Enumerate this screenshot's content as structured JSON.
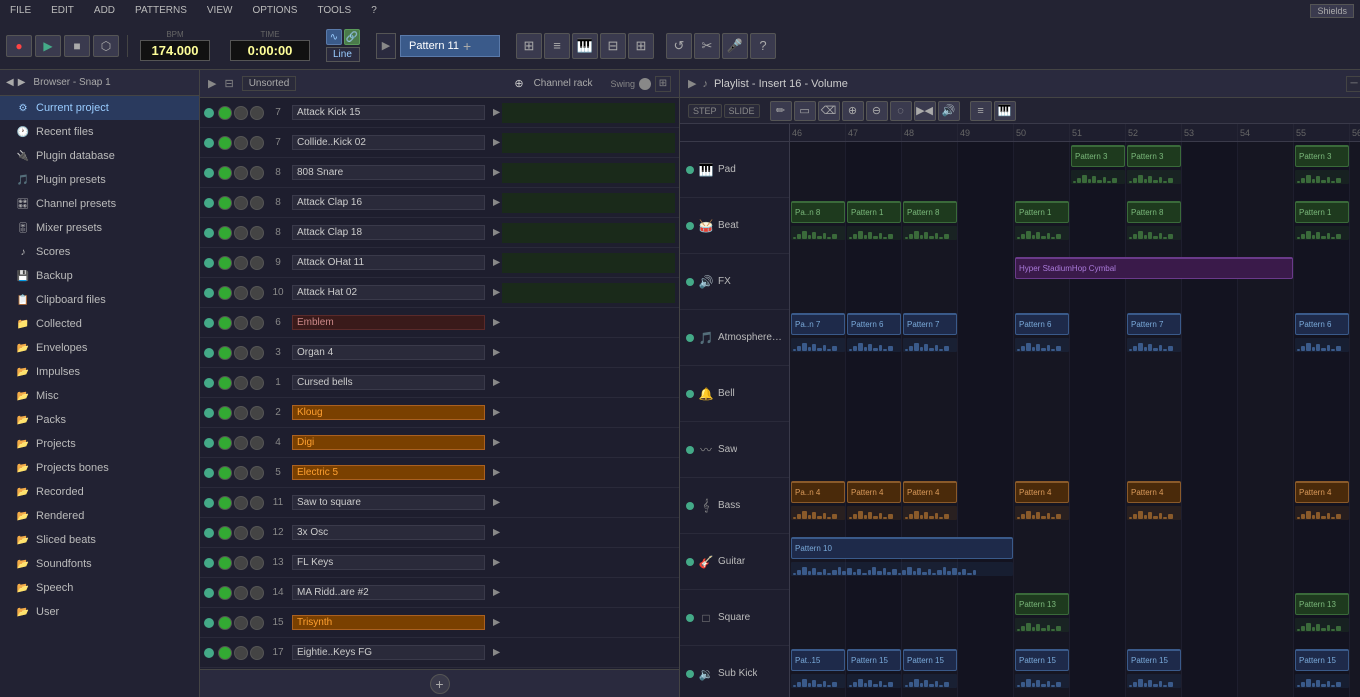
{
  "menu": {
    "items": [
      "FILE",
      "EDIT",
      "ADD",
      "PATTERNS",
      "VIEW",
      "OPTIONS",
      "TOOLS",
      "?"
    ]
  },
  "transport": {
    "bpm": "174.000",
    "time": "0:00:00",
    "pattern": "Pattern 11",
    "line_mode": "Line",
    "buttons": {
      "record": "●",
      "play": "▶",
      "stop": "■",
      "pattern": "⬡"
    }
  },
  "channel_rack": {
    "title": "Channel rack",
    "label_unsorted": "Unsorted",
    "swing_label": "Swing",
    "channels": [
      {
        "num": "7",
        "name": "Attack Kick 15",
        "color": "default",
        "led": true
      },
      {
        "num": "7",
        "name": "Collide..Kick 02",
        "color": "default",
        "led": true
      },
      {
        "num": "8",
        "name": "808 Snare",
        "color": "default",
        "led": true
      },
      {
        "num": "8",
        "name": "Attack Clap 16",
        "color": "default",
        "led": true
      },
      {
        "num": "8",
        "name": "Attack Clap 18",
        "color": "default",
        "led": true
      },
      {
        "num": "9",
        "name": "Attack OHat 11",
        "color": "default",
        "led": true
      },
      {
        "num": "10",
        "name": "Attack Hat 02",
        "color": "default",
        "led": true
      },
      {
        "num": "6",
        "name": "Emblem",
        "color": "dark",
        "led": true
      },
      {
        "num": "3",
        "name": "Organ 4",
        "color": "default",
        "led": true
      },
      {
        "num": "1",
        "name": "Cursed bells",
        "color": "default",
        "led": true
      },
      {
        "num": "2",
        "name": "Kloug",
        "color": "orange",
        "led": true
      },
      {
        "num": "4",
        "name": "Digi",
        "color": "orange",
        "led": true
      },
      {
        "num": "5",
        "name": "Electric 5",
        "color": "orange",
        "led": true
      },
      {
        "num": "11",
        "name": "Saw to square",
        "color": "default",
        "led": true
      },
      {
        "num": "12",
        "name": "3x Osc",
        "color": "default",
        "led": true
      },
      {
        "num": "13",
        "name": "FL Keys",
        "color": "default",
        "led": true
      },
      {
        "num": "14",
        "name": "MA Ridd..are #2",
        "color": "default",
        "led": true
      },
      {
        "num": "15",
        "name": "Trisynth",
        "color": "orange",
        "led": true
      },
      {
        "num": "17",
        "name": "Eightie..Keys FG",
        "color": "default",
        "led": true
      }
    ]
  },
  "sidebar": {
    "header": "Browser - Snap 1",
    "items": [
      {
        "label": "Current project",
        "icon": "🏠",
        "type": "active"
      },
      {
        "label": "Recent files",
        "icon": "🕐",
        "type": "folder"
      },
      {
        "label": "Plugin database",
        "icon": "🔌",
        "type": "folder"
      },
      {
        "label": "Plugin presets",
        "icon": "🎵",
        "type": "folder"
      },
      {
        "label": "Channel presets",
        "icon": "🎛",
        "type": "folder"
      },
      {
        "label": "Mixer presets",
        "icon": "🎚",
        "type": "folder"
      },
      {
        "label": "Scores",
        "icon": "♪",
        "type": "folder"
      },
      {
        "label": "Backup",
        "icon": "💾",
        "type": "folder"
      },
      {
        "label": "Clipboard files",
        "icon": "📋",
        "type": "folder"
      },
      {
        "label": "Collected",
        "icon": "📁",
        "type": "folder"
      },
      {
        "label": "Envelopes",
        "icon": "📁",
        "type": "folder"
      },
      {
        "label": "Impulses",
        "icon": "📁",
        "type": "folder"
      },
      {
        "label": "Misc",
        "icon": "📁",
        "type": "folder"
      },
      {
        "label": "Packs",
        "icon": "📁",
        "type": "folder"
      },
      {
        "label": "Projects",
        "icon": "📁",
        "type": "folder"
      },
      {
        "label": "Projects bones",
        "icon": "📁",
        "type": "folder"
      },
      {
        "label": "Recorded",
        "icon": "📁",
        "type": "folder"
      },
      {
        "label": "Rendered",
        "icon": "📁",
        "type": "folder"
      },
      {
        "label": "Sliced beats",
        "icon": "📁",
        "type": "folder"
      },
      {
        "label": "Soundfonts",
        "icon": "📁",
        "type": "folder"
      },
      {
        "label": "Speech",
        "icon": "📁",
        "type": "folder"
      },
      {
        "label": "User",
        "icon": "📁",
        "type": "folder"
      }
    ]
  },
  "playlist": {
    "title": "Playlist - Insert 16 - Volume",
    "timeline_marks": [
      "46",
      "47",
      "48",
      "49",
      "50",
      "51",
      "52",
      "53",
      "54",
      "55",
      "56"
    ],
    "tracks": [
      {
        "name": "Pad",
        "icon": "🎹",
        "patterns": [
          {
            "label": "Pattern 3",
            "start": 5,
            "width": 1,
            "color": "green"
          },
          {
            "label": "Pattern 3",
            "start": 6,
            "width": 1,
            "color": "green"
          },
          {
            "label": "Pattern 3",
            "start": 9,
            "width": 1,
            "color": "green"
          }
        ]
      },
      {
        "name": "Beat",
        "icon": "🥁",
        "patterns": [
          {
            "label": "Pa..n 8",
            "start": 0,
            "width": 1,
            "color": "green"
          },
          {
            "label": "Pattern 1",
            "start": 1,
            "width": 1,
            "color": "green"
          },
          {
            "label": "Pattern 8",
            "start": 2,
            "width": 1,
            "color": "green"
          },
          {
            "label": "Pattern 1",
            "start": 4,
            "width": 1,
            "color": "green"
          },
          {
            "label": "Pattern 8",
            "start": 6,
            "width": 1,
            "color": "green"
          },
          {
            "label": "Pattern 1",
            "start": 9,
            "width": 1,
            "color": "green"
          }
        ]
      },
      {
        "name": "FX",
        "icon": "🔊",
        "patterns": [
          {
            "label": "Hyper StadiumHop Cymbal",
            "start": 4,
            "width": 5,
            "color": "purple"
          }
        ]
      },
      {
        "name": "Atmosphere Arp",
        "icon": "🎵",
        "patterns": [
          {
            "label": "Pa..n 7",
            "start": 0,
            "width": 1,
            "color": "blue"
          },
          {
            "label": "Pattern 6",
            "start": 1,
            "width": 1,
            "color": "blue"
          },
          {
            "label": "Pattern 7",
            "start": 2,
            "width": 1,
            "color": "blue"
          },
          {
            "label": "Pattern 6",
            "start": 4,
            "width": 1,
            "color": "blue"
          },
          {
            "label": "Pattern 7",
            "start": 6,
            "width": 1,
            "color": "blue"
          },
          {
            "label": "Pattern 6",
            "start": 9,
            "width": 1,
            "color": "blue"
          }
        ]
      },
      {
        "name": "Bell",
        "icon": "🔔",
        "patterns": []
      },
      {
        "name": "Saw",
        "icon": "〰",
        "patterns": []
      },
      {
        "name": "Bass",
        "icon": "🎸",
        "patterns": [
          {
            "label": "Pa..n 4",
            "start": 0,
            "width": 1,
            "color": "orange"
          },
          {
            "label": "Pattern 4",
            "start": 1,
            "width": 1,
            "color": "orange"
          },
          {
            "label": "Pattern 4",
            "start": 2,
            "width": 1,
            "color": "orange"
          },
          {
            "label": "Pattern 4",
            "start": 4,
            "width": 1,
            "color": "orange"
          },
          {
            "label": "Pattern 4",
            "start": 6,
            "width": 1,
            "color": "orange"
          },
          {
            "label": "Pattern 4",
            "start": 9,
            "width": 1,
            "color": "orange"
          }
        ]
      },
      {
        "name": "Guitar",
        "icon": "🎸",
        "patterns": [
          {
            "label": "Pattern 10",
            "start": 0,
            "width": 4,
            "color": "blue"
          }
        ]
      },
      {
        "name": "Square",
        "icon": "□",
        "patterns": [
          {
            "label": "Pattern 13",
            "start": 4,
            "width": 1,
            "color": "green"
          },
          {
            "label": "Pattern 13",
            "start": 9,
            "width": 1,
            "color": "green"
          }
        ]
      },
      {
        "name": "Sub Kick",
        "icon": "🔉",
        "patterns": [
          {
            "label": "Pat..15",
            "start": 0,
            "width": 1,
            "color": "blue"
          },
          {
            "label": "Pattern 15",
            "start": 1,
            "width": 1,
            "color": "blue"
          },
          {
            "label": "Pattern 15",
            "start": 2,
            "width": 1,
            "color": "blue"
          },
          {
            "label": "Pattern 15",
            "start": 4,
            "width": 1,
            "color": "blue"
          },
          {
            "label": "Pattern 15",
            "start": 6,
            "width": 1,
            "color": "blue"
          },
          {
            "label": "Pattern 15",
            "start": 9,
            "width": 1,
            "color": "blue"
          }
        ]
      }
    ]
  }
}
